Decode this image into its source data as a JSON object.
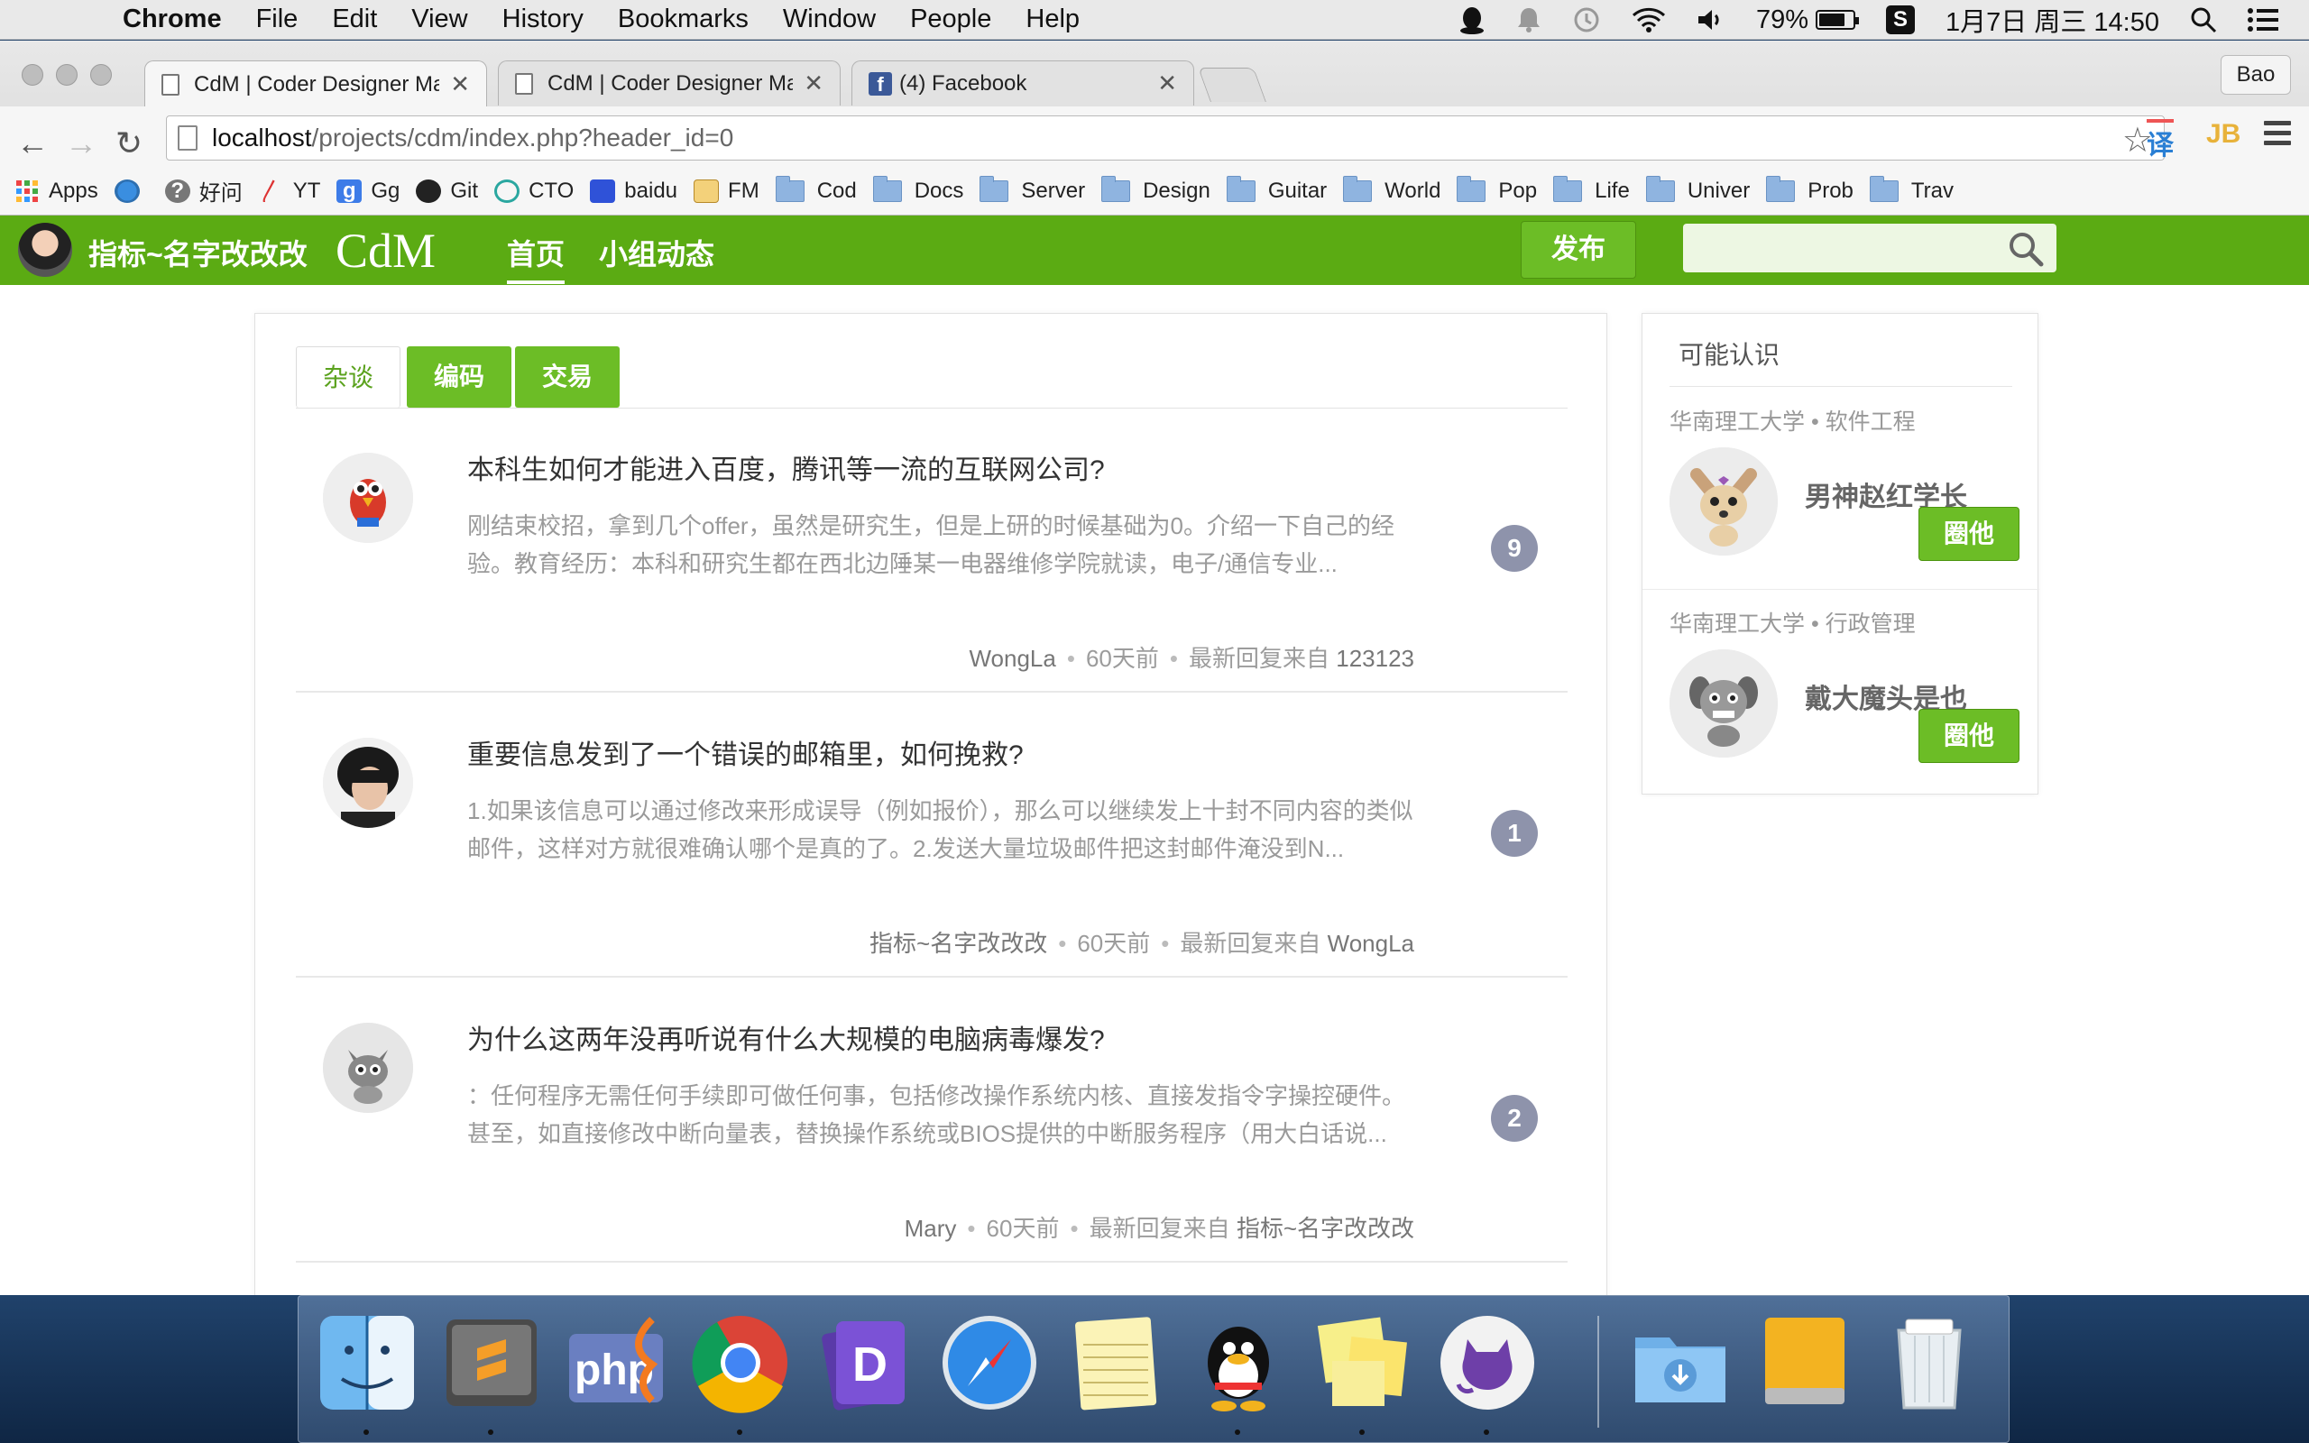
{
  "menubar": {
    "app": "Chrome",
    "items": [
      "File",
      "Edit",
      "View",
      "History",
      "Bookmarks",
      "Window",
      "People",
      "Help"
    ],
    "battery": "79%",
    "battery_level": 0.79,
    "datetime": "1月7日 周三  14:50"
  },
  "browser": {
    "tabs": [
      {
        "title": "CdM | Coder Designer Manager",
        "active": true
      },
      {
        "title": "CdM | Coder Designer Manager",
        "active": false
      },
      {
        "title": "(4) Facebook",
        "active": false
      }
    ],
    "profile": "Bao",
    "url_host": "localhost",
    "url_path": "/projects/cdm/index.php?header_id=0",
    "bookmarks": [
      "Apps",
      "好问",
      "YT",
      "Gg",
      "Git",
      "CTO",
      "baidu",
      "FM",
      "Cod",
      "Docs",
      "Server",
      "Design",
      "Guitar",
      "World",
      "Pop",
      "Life",
      "Univer",
      "Prob",
      "Trav"
    ],
    "extensions": {
      "translate": "译",
      "jb": "JB"
    }
  },
  "site": {
    "username": "指标~名字改改改",
    "logo": "CdM",
    "nav": [
      "首页",
      "小组动态"
    ],
    "publish": "发布",
    "search_placeholder": "",
    "brand_color": "#5bab13"
  },
  "content": {
    "tabs": [
      "杂谈",
      "编码",
      "交易"
    ],
    "posts": [
      {
        "title": "本科生如何才能进入百度，腾讯等一流的互联网公司?",
        "excerpt": "刚结束校招，拿到几个offer，虽然是研究生，但是上研的时候基础为0。介绍一下自己的经验。教育经历：本科和研究生都在西北边陲某一电器维修学院就读，电子/通信专业...",
        "count": "9",
        "author": "WongLa",
        "time": "60天前",
        "reply_label": "最新回复来自",
        "last_reply": "123123"
      },
      {
        "title": "重要信息发到了一个错误的邮箱里，如何挽救?",
        "excerpt": "1.如果该信息可以通过修改来形成误导（例如报价），那么可以继续发上十封不同内容的类似邮件，这样对方就很难确认哪个是真的了。2.发送大量垃圾邮件把这封邮件淹没到N...",
        "count": "1",
        "author": "指标~名字改改改",
        "time": "60天前",
        "reply_label": "最新回复来自",
        "last_reply": "WongLa"
      },
      {
        "title": "为什么这两年没再听说有什么大规模的电脑病毒爆发?",
        "excerpt": "：任何程序无需任何手续即可做任何事，包括修改操作系统内核、直接发指令字操控硬件。甚至，如直接修改中断向量表，替换操作系统或BIOS提供的中断服务程序（用大白话说...",
        "count": "2",
        "author": "Mary",
        "time": "60天前",
        "reply_label": "最新回复来自",
        "last_reply": "指标~名字改改改"
      }
    ]
  },
  "sidebar": {
    "title": "可能认识",
    "people": [
      {
        "school": "华南理工大学 • 软件工程",
        "name": "男神赵红学长",
        "button": "圈他"
      },
      {
        "school": "华南理工大学 • 行政管理",
        "name": "戴大魔头是也",
        "button": "圈他"
      }
    ]
  },
  "dock": {
    "apps": [
      "finder-icon",
      "sublime-text-icon",
      "php-storm-icon",
      "chrome-icon",
      "dash-icon",
      "safari-icon",
      "notes-icon",
      "qq-icon",
      "stickies-icon",
      "github-icon",
      "downloads-folder-icon",
      "external-drive-icon",
      "trash-icon"
    ]
  }
}
